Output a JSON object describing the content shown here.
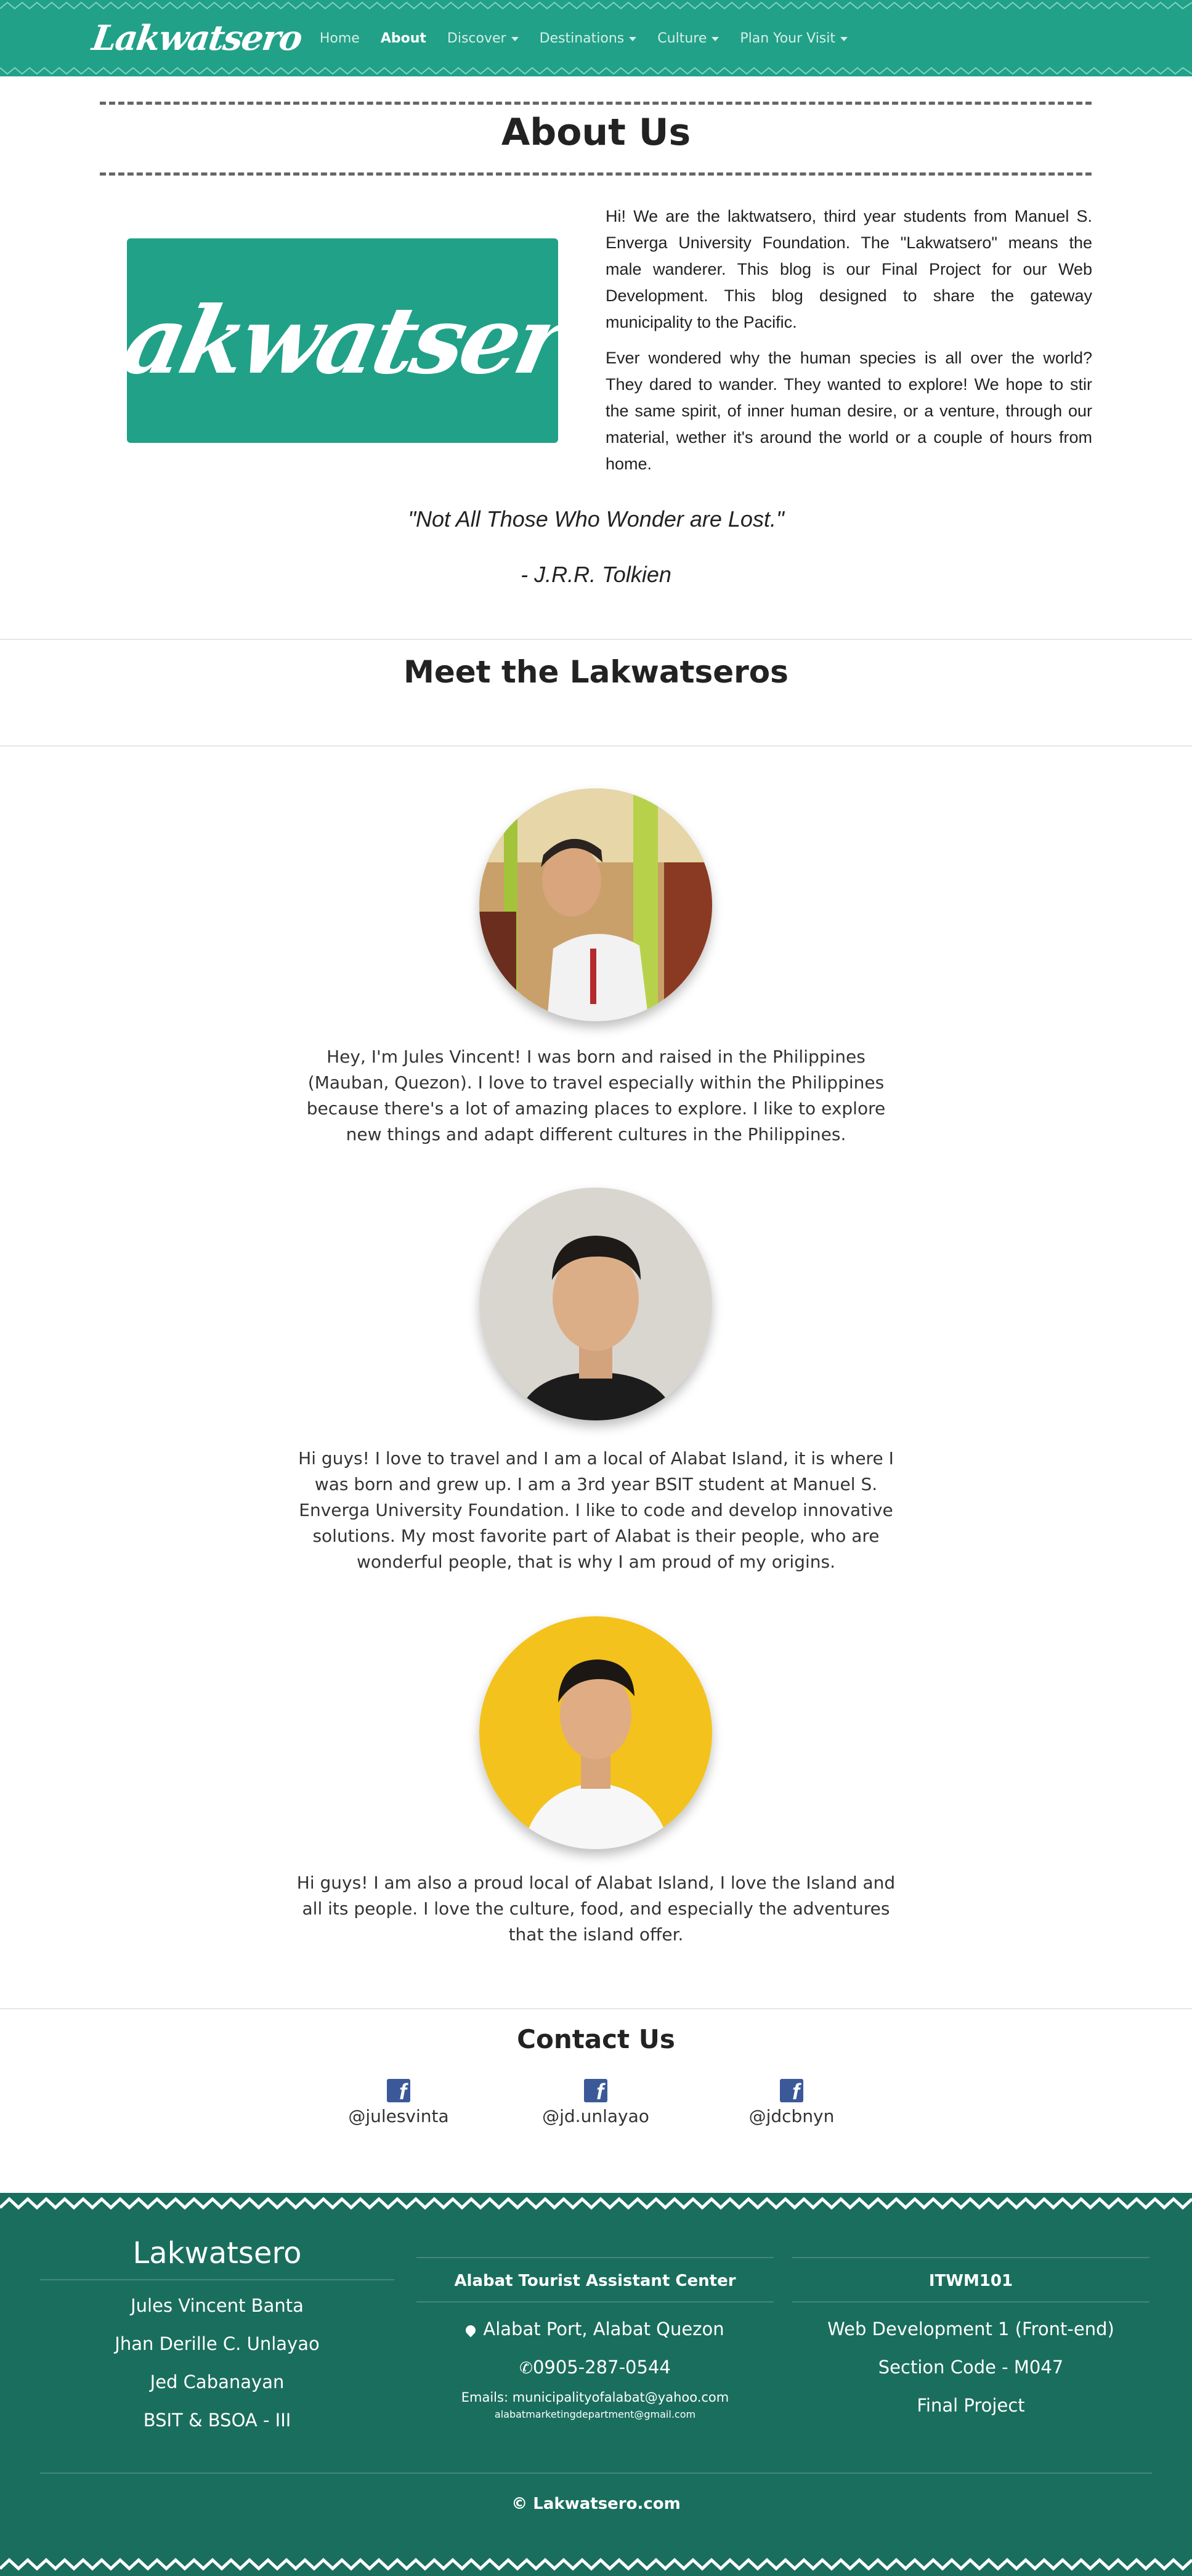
{
  "nav": {
    "brand": "Lakwatsero",
    "links": [
      {
        "label": "Home",
        "dropdown": false,
        "active": false
      },
      {
        "label": "About",
        "dropdown": false,
        "active": true
      },
      {
        "label": "Discover",
        "dropdown": true,
        "active": false
      },
      {
        "label": "Destinations",
        "dropdown": true,
        "active": false
      },
      {
        "label": "Culture",
        "dropdown": true,
        "active": false
      },
      {
        "label": "Plan Your Visit",
        "dropdown": true,
        "active": false
      }
    ]
  },
  "about": {
    "title": "About Us",
    "logo_text": "Lakwatsero",
    "paragraph1": "Hi! We are the laktwatsero, third year students from Manuel S. Enverga University Foundation. The \"Lakwatsero\" means the male wanderer. This blog is our Final Project for our Web Development. This blog designed to share the gateway municipality to the Pacific.",
    "paragraph2": "Ever wondered why the human species is all over the world? They dared to wander. They wanted to explore! We hope to stir the same spirit, of inner human desire, or a venture, through our material, wether it's around the world or a couple of hours from home.",
    "quote": "\"Not All Those Who Wonder are Lost.\"",
    "quote_author": "- J.R.R. Tolkien"
  },
  "meet": {
    "title": "Meet the Lakwatseros",
    "members": [
      {
        "bio": "Hey, I'm Jules Vincent! I was born and raised in the Philippines (Mauban, Quezon). I love to travel especially within the Philippines because there's a lot of amazing places to explore. I like to explore new things and adapt different cultures in the Philippines."
      },
      {
        "bio": "Hi guys! I love to travel and I am a local of Alabat Island, it is where I was born and grew up. I am a 3rd year BSIT student at Manuel S. Enverga University Foundation. I like to code and develop innovative solutions. My most favorite part of Alabat is their people, who are wonderful people, that is why I am proud of my origins."
      },
      {
        "bio": "Hi guys! I am also a proud local of Alabat Island, I love the Island and all its people. I love the culture, food, and especially the adventures that the island offer."
      }
    ]
  },
  "contact": {
    "title": "Contact Us",
    "handles": [
      "@julesvinta",
      "@jd.unlayao",
      "@jdcbnyn"
    ]
  },
  "footer": {
    "col1": {
      "title": "Lakwatsero",
      "items": [
        "Jules Vincent Banta",
        "Jhan Derille C. Unlayao",
        "Jed Cabanayan",
        "BSIT & BSOA - III"
      ]
    },
    "col2": {
      "title": "Alabat Tourist Assistant Center",
      "address": "Alabat Port, Alabat Quezon",
      "phone": "0905-287-0544",
      "emails_line1": "Emails: municipalityofalabat@yahoo.com",
      "emails_line2": "alabatmarketingdepartment@gmail.com"
    },
    "col3": {
      "title": "ITWM101",
      "items": [
        "Web Development 1 (Front-end)",
        "Section Code - M047",
        "Final Project"
      ]
    },
    "copyright": "© Lakwatsero.com"
  },
  "colors": {
    "primary": "#21a188",
    "footer": "#1a6e5d",
    "facebook": "#3b5998"
  }
}
